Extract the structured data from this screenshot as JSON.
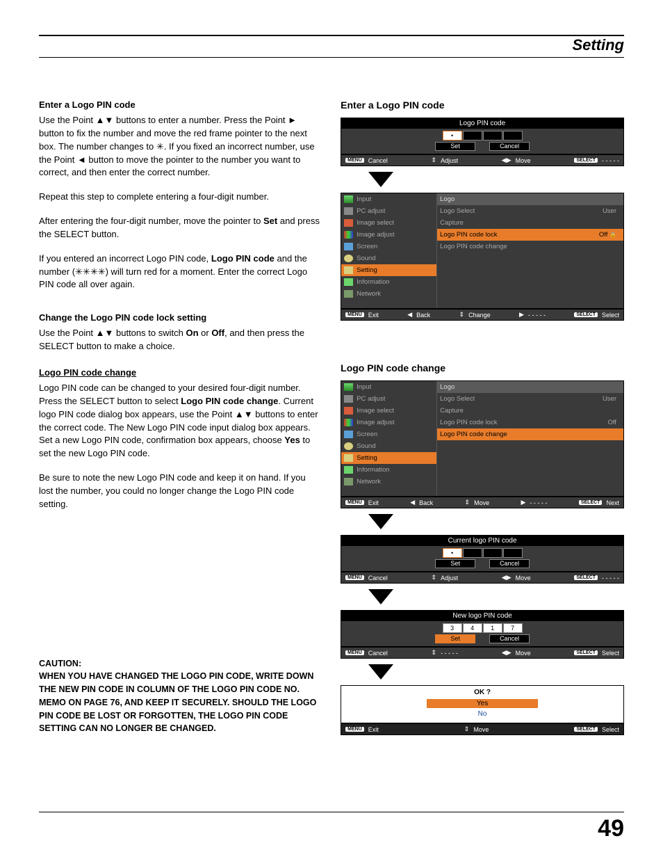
{
  "header": {
    "title": "Setting"
  },
  "left": {
    "s1_title": "Enter a Logo PIN code",
    "s1_p1a": "Use the Point ",
    "s1_p1b": " buttons to enter a number. Press the Point ",
    "s1_p1c": " button to fix the number and move the red frame pointer to the next box. The number changes to ",
    "s1_p1d": ". If you fixed an incorrect number, use the Point ",
    "s1_p1e": " button to move the pointer to the number you want to correct, and then enter the correct number.",
    "s1_p2": "Repeat this step to complete entering a four-digit number.",
    "s1_p3a": "After entering the four-digit number, move the pointer to ",
    "s1_p3b": " and press the SELECT button.",
    "s1_set": "Set",
    "s1_p4a": "If you entered an incorrect Logo PIN code, ",
    "s1_p4b": " and the number (",
    "s1_p4c": ") will turn red for a moment. Enter the correct Logo PIN code all over again.",
    "s1_bold_logo": "Logo PIN code",
    "s2_title": "Change the Logo PIN code lock setting",
    "s2_p1a": "Use the Point ",
    "s2_p1b": " buttons to switch ",
    "s2_on": "On",
    "s2_or": " or ",
    "s2_off": "Off",
    "s2_p1c": ", and then press the SELECT button to make a choice.",
    "s3_title": "Logo PIN code change",
    "s3_p1a": "Logo PIN code can be changed to your desired four-digit number. Press the SELECT button to select ",
    "s3_bold": "Logo PIN code change",
    "s3_p1b": ". Current logo PIN code dialog box appears, use the Point ",
    "s3_p1c": " buttons to enter the correct code. The New Logo PIN code input dialog box appears. Set a new Logo PIN code, confirmation box appears, choose ",
    "s3_yes": "Yes",
    "s3_p1d": " to set the new Logo PIN code.",
    "s3_p2": "Be sure to note the new Logo PIN code and keep it on hand. If you lost the number, you could no longer change the Logo PIN code setting.",
    "caution_label": "CAUTION:",
    "caution_text": "WHEN YOU HAVE CHANGED THE LOGO PIN CODE, WRITE DOWN THE NEW PIN CODE IN COLUMN OF THE LOGO PIN CODE NO. MEMO ON PAGE 76, AND KEEP IT SECURELY. SHOULD THE LOGO PIN CODE BE LOST OR FORGOTTEN, THE LOGO PIN CODE SETTING CAN NO LONGER BE CHANGED."
  },
  "right": {
    "title1": "Enter a Logo PIN code",
    "pin_title": "Logo PIN code",
    "pin_set": "Set",
    "pin_cancel": "Cancel",
    "hint_menu": "MENU",
    "hint_cancel": "Cancel",
    "hint_adjust": "Adjust",
    "hint_move": "Move",
    "hint_select_lbl": "SELECT",
    "hint_dashes": "- - - - -",
    "hint_exit": "Exit",
    "hint_back": "Back",
    "hint_change": "Change",
    "hint_select": "Select",
    "hint_next": "Next",
    "menu_left": [
      "Input",
      "PC adjust",
      "Image select",
      "Image adjust",
      "Screen",
      "Sound",
      "Setting",
      "Information",
      "Network"
    ],
    "menu_hdr": "Logo",
    "menu_right_a": [
      {
        "label": "Logo Select",
        "val": "User"
      },
      {
        "label": "Capture",
        "val": ""
      },
      {
        "label": "Logo PIN code lock",
        "val": "Off",
        "hl": true,
        "lock": true
      },
      {
        "label": "Logo PIN code change",
        "val": ""
      }
    ],
    "title2": "Logo PIN code change",
    "menu_right_b": [
      {
        "label": "Logo Select",
        "val": "User"
      },
      {
        "label": "Capture",
        "val": ""
      },
      {
        "label": "Logo PIN code lock",
        "val": "Off"
      },
      {
        "label": "Logo PIN code change",
        "val": "",
        "hl": true
      }
    ],
    "current_title": "Current logo PIN code",
    "new_title": "New logo PIN code",
    "new_digits": [
      "3",
      "4",
      "1",
      "7"
    ],
    "ok_title": "OK ?",
    "ok_yes": "Yes",
    "ok_no": "No"
  },
  "glyph": {
    "updown": "▲▼",
    "right": "►",
    "left": "◄",
    "star": "✳",
    "stars4": "✳✳✳✳",
    "ud_arrows": "⇕",
    "lr_arrows": "◀▶",
    "tri_left": "◀",
    "tri_right": "▶"
  },
  "page_number": "49"
}
